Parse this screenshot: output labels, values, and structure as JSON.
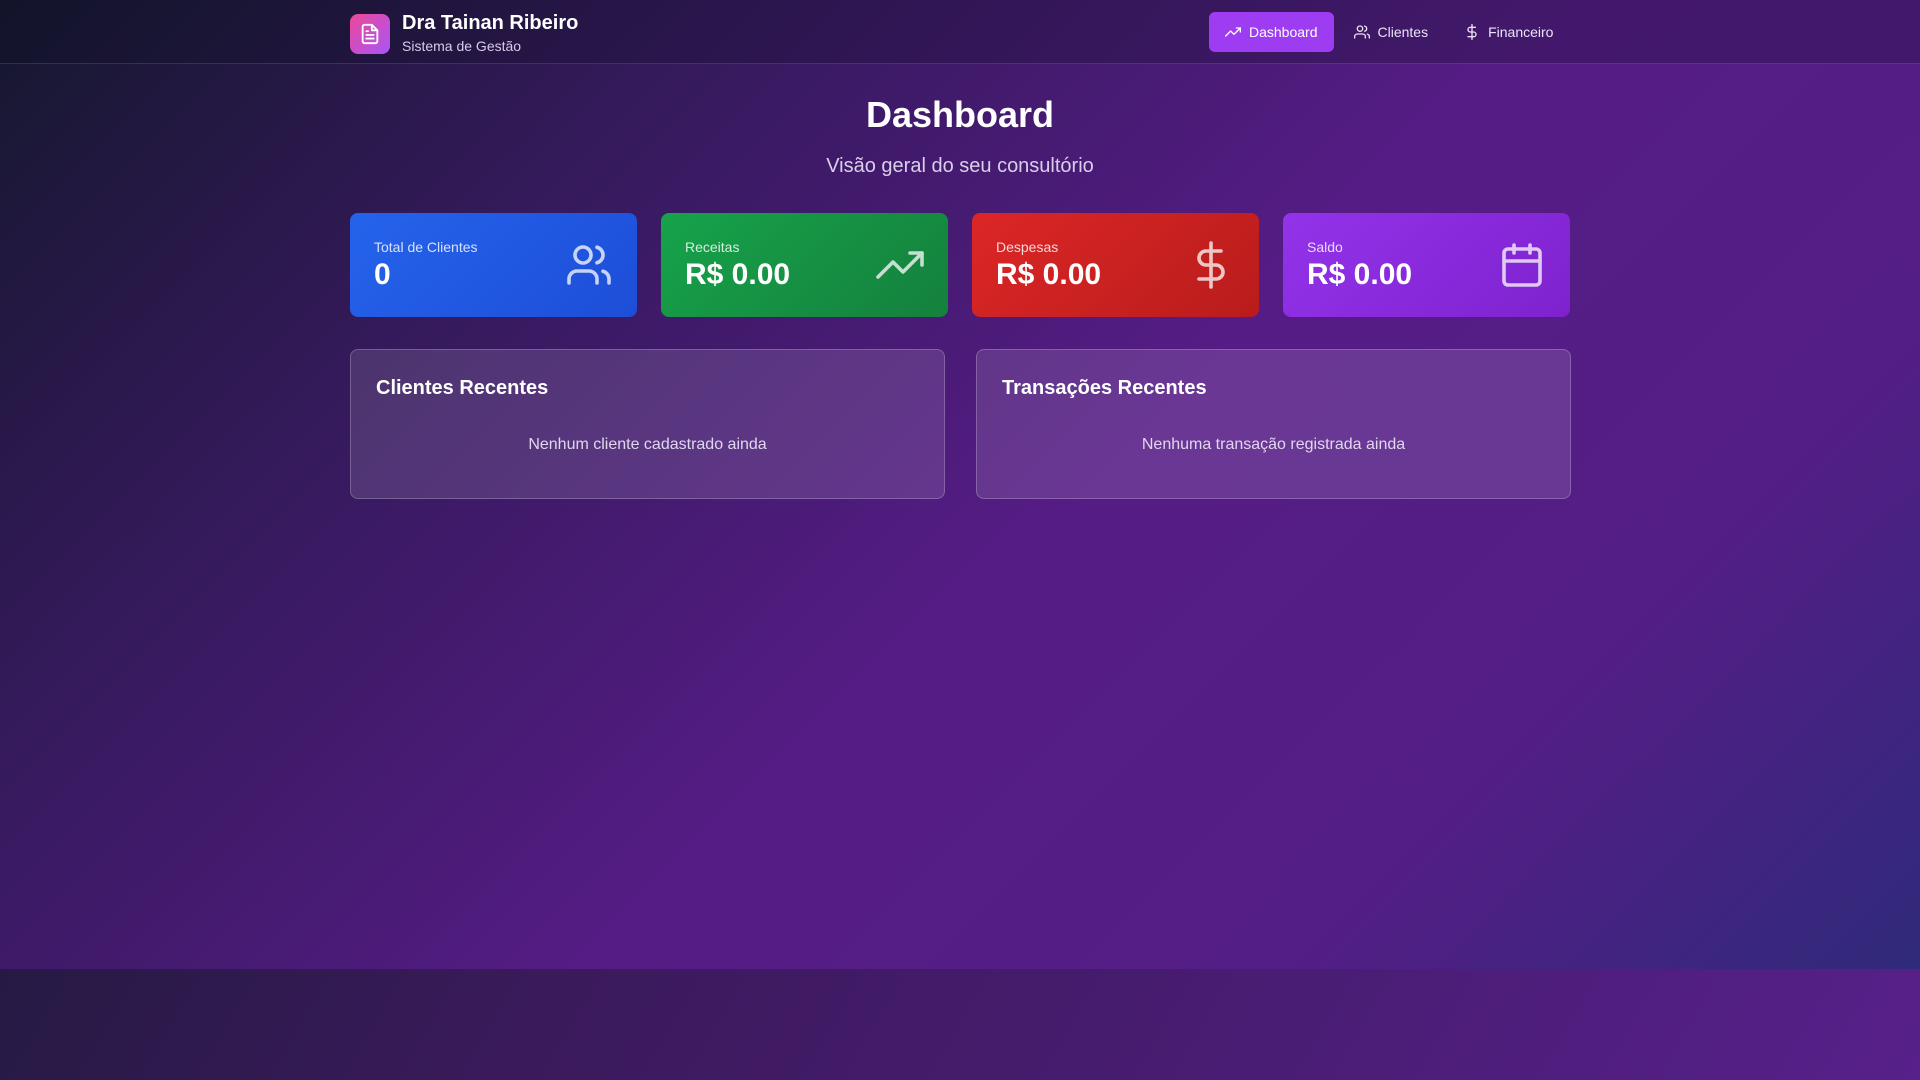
{
  "header": {
    "brand_title": "Dra Tainan Ribeiro",
    "brand_subtitle": "Sistema de Gestão",
    "logo_icon": "document-icon",
    "nav": [
      {
        "label": "Dashboard",
        "icon": "trending-up-icon",
        "active": true
      },
      {
        "label": "Clientes",
        "icon": "users-icon",
        "active": false
      },
      {
        "label": "Financeiro",
        "icon": "dollar-icon",
        "active": false
      }
    ]
  },
  "hero": {
    "title": "Dashboard",
    "subtitle": "Visão geral do seu consultório"
  },
  "stats": [
    {
      "label": "Total de Clientes",
      "value": "0",
      "icon": "users-icon",
      "color": "#2563eb"
    },
    {
      "label": "Receitas",
      "value": "R$ 0.00",
      "icon": "trending-up-icon",
      "color": "#16a34a"
    },
    {
      "label": "Despesas",
      "value": "R$ 0.00",
      "icon": "dollar-icon",
      "color": "#dc2626"
    },
    {
      "label": "Saldo",
      "value": "R$ 0.00",
      "icon": "calendar-icon",
      "color": "#9333ea"
    }
  ],
  "panels": {
    "recent_clients": {
      "title": "Clientes Recentes",
      "empty": "Nenhum cliente cadastrado ainda"
    },
    "recent_transactions": {
      "title": "Transações Recentes",
      "empty": "Nenhuma transação registrada ainda"
    }
  }
}
